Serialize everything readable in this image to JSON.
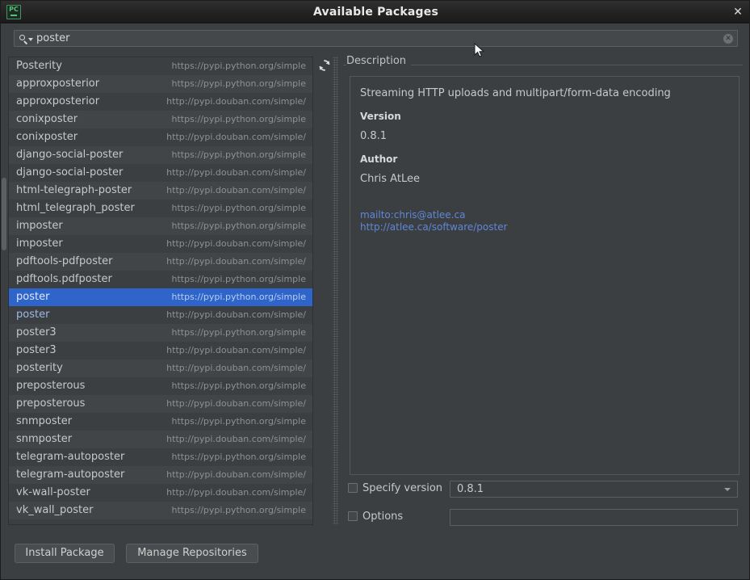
{
  "window": {
    "title": "Available Packages",
    "app_icon": "pycharm-icon",
    "close_label": "✕"
  },
  "search": {
    "value": "poster",
    "placeholder": "",
    "icon": "search-icon",
    "clear_label": "✕"
  },
  "list": {
    "refresh_icon": "refresh-icon",
    "rows": [
      {
        "name": "Posterity",
        "repo": "https://pypi.python.org/simple",
        "selected": false,
        "installed": false
      },
      {
        "name": "approxposterior",
        "repo": "https://pypi.python.org/simple",
        "selected": false,
        "installed": false
      },
      {
        "name": "approxposterior",
        "repo": "http://pypi.douban.com/simple/",
        "selected": false,
        "installed": false
      },
      {
        "name": "conixposter",
        "repo": "https://pypi.python.org/simple",
        "selected": false,
        "installed": false
      },
      {
        "name": "conixposter",
        "repo": "http://pypi.douban.com/simple/",
        "selected": false,
        "installed": false
      },
      {
        "name": "django-social-poster",
        "repo": "https://pypi.python.org/simple",
        "selected": false,
        "installed": false
      },
      {
        "name": "django-social-poster",
        "repo": "http://pypi.douban.com/simple/",
        "selected": false,
        "installed": false
      },
      {
        "name": "html-telegraph-poster",
        "repo": "http://pypi.douban.com/simple/",
        "selected": false,
        "installed": false
      },
      {
        "name": "html_telegraph_poster",
        "repo": "https://pypi.python.org/simple",
        "selected": false,
        "installed": false
      },
      {
        "name": "imposter",
        "repo": "https://pypi.python.org/simple",
        "selected": false,
        "installed": false
      },
      {
        "name": "imposter",
        "repo": "http://pypi.douban.com/simple/",
        "selected": false,
        "installed": false
      },
      {
        "name": "pdftools-pdfposter",
        "repo": "http://pypi.douban.com/simple/",
        "selected": false,
        "installed": false
      },
      {
        "name": "pdftools.pdfposter",
        "repo": "https://pypi.python.org/simple",
        "selected": false,
        "installed": false
      },
      {
        "name": "poster",
        "repo": "https://pypi.python.org/simple",
        "selected": true,
        "installed": true
      },
      {
        "name": "poster",
        "repo": "http://pypi.douban.com/simple/",
        "selected": false,
        "installed": true
      },
      {
        "name": "poster3",
        "repo": "https://pypi.python.org/simple",
        "selected": false,
        "installed": false
      },
      {
        "name": "poster3",
        "repo": "http://pypi.douban.com/simple/",
        "selected": false,
        "installed": false
      },
      {
        "name": "posterity",
        "repo": "http://pypi.douban.com/simple/",
        "selected": false,
        "installed": false
      },
      {
        "name": "preposterous",
        "repo": "https://pypi.python.org/simple",
        "selected": false,
        "installed": false
      },
      {
        "name": "preposterous",
        "repo": "http://pypi.douban.com/simple/",
        "selected": false,
        "installed": false
      },
      {
        "name": "snmposter",
        "repo": "https://pypi.python.org/simple",
        "selected": false,
        "installed": false
      },
      {
        "name": "snmposter",
        "repo": "http://pypi.douban.com/simple/",
        "selected": false,
        "installed": false
      },
      {
        "name": "telegram-autoposter",
        "repo": "https://pypi.python.org/simple",
        "selected": false,
        "installed": false
      },
      {
        "name": "telegram-autoposter",
        "repo": "http://pypi.douban.com/simple/",
        "selected": false,
        "installed": false
      },
      {
        "name": "vk-wall-poster",
        "repo": "http://pypi.douban.com/simple/",
        "selected": false,
        "installed": false
      },
      {
        "name": "vk_wall_poster",
        "repo": "https://pypi.python.org/simple",
        "selected": false,
        "installed": false
      }
    ]
  },
  "description": {
    "panel_title": "Description",
    "summary": "Streaming HTTP uploads and multipart/form-data encoding",
    "version_heading": "Version",
    "version_value": "0.8.1",
    "author_heading": "Author",
    "author_value": "Chris AtLee",
    "links": [
      "mailto:chris@atlee.ca",
      "http://atlee.ca/software/poster"
    ]
  },
  "options": {
    "specify_version_label": "Specify version",
    "specify_version_checked": false,
    "version_selected": "0.8.1",
    "options_label": "Options",
    "options_checked": false,
    "options_value": "",
    "options_placeholder": ""
  },
  "footer": {
    "install_label": "Install Package",
    "manage_label": "Manage Repositories"
  },
  "colors": {
    "window_bg": "#3c3f41",
    "selection_blue": "#2f65ca",
    "link_blue": "#5f87d8",
    "text": "#c8c8c8",
    "muted_text": "#8e9194",
    "accent_green": "#59c07a"
  }
}
